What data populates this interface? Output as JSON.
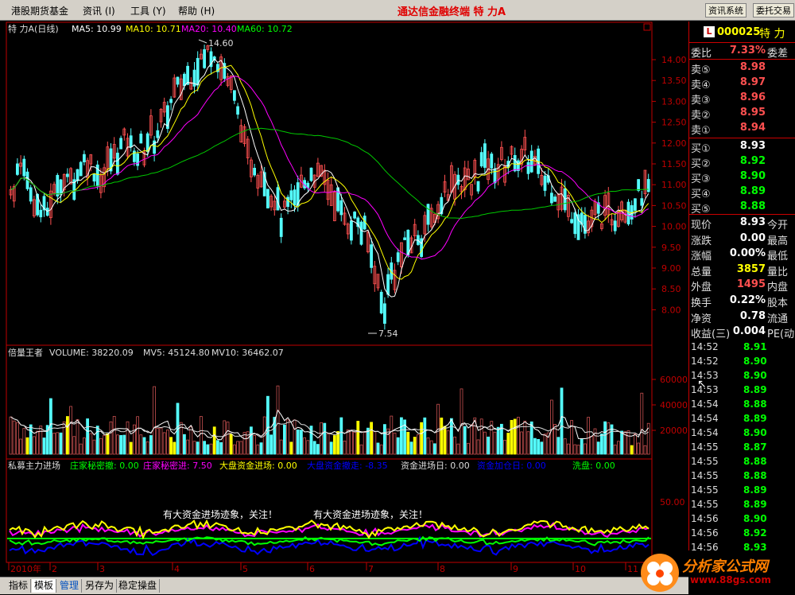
{
  "menubar": {
    "items": [
      "港股期货基金",
      "资讯 (I)",
      "工具 (Y)",
      "帮助 (H)"
    ],
    "title": "通达信金融终端  特  力A",
    "buttons": [
      "资讯系统",
      "委托交易"
    ]
  },
  "price_panel": {
    "header_name": "特  力A(日线)",
    "ma5": "MA5: 10.99",
    "ma10": "MA10: 10.71",
    "ma20": "MA20: 10.40",
    "ma60": "MA60: 10.72",
    "high_label": "14.60",
    "low_label": "7.54",
    "y_ticks": [
      "14.00",
      "13.50",
      "13.00",
      "12.50",
      "12.00",
      "11.50",
      "11.00",
      "10.50",
      "10.00",
      "9.50",
      "9.00",
      "8.50",
      "8.00"
    ]
  },
  "volume_panel": {
    "name": "倍量王者",
    "volume": "VOLUME: 38220.09",
    "mv5": "MV5: 45124.80",
    "mv10": "MV10: 36462.07",
    "y_ticks": [
      "60000",
      "40000",
      "20000"
    ]
  },
  "indicator_panel": {
    "name": "私募主力进场",
    "items": [
      {
        "text": "庄家秘密撤: 0.00",
        "color": "#00ff00"
      },
      {
        "text": "庄家秘密进: 7.50",
        "color": "#ff00ff"
      },
      {
        "text": "大盘资金进场: 0.00",
        "color": "#ffff00"
      },
      {
        "text": "大盘资金撤走: -8.35",
        "color": "#0000ff"
      },
      {
        "text": "资金进场日: 0.00",
        "color": "#dddddd"
      },
      {
        "text": "资金加仓日: 0.00",
        "color": "#0000ff"
      },
      {
        "text": "洗盘: 0.00",
        "color": "#00ff00"
      }
    ],
    "notes": [
      "有大资金进场迹象，关注！",
      "有大资金进场迹象，关注！"
    ],
    "y_tick": "50.00"
  },
  "date_axis": [
    "2010年",
    "2",
    "3",
    "4",
    "5",
    "6",
    "7",
    "8",
    "9",
    "10",
    "11"
  ],
  "quote": {
    "badge": "L",
    "code": "000025",
    "name": "特  力",
    "weibi": {
      "label": "委比",
      "value": "7.33%",
      "label2": "委差"
    },
    "sells": [
      {
        "label": "卖⑤",
        "price": "8.98"
      },
      {
        "label": "卖④",
        "price": "8.97"
      },
      {
        "label": "卖③",
        "price": "8.96"
      },
      {
        "label": "卖②",
        "price": "8.95"
      },
      {
        "label": "卖①",
        "price": "8.94"
      }
    ],
    "buys": [
      {
        "label": "买①",
        "price": "8.93"
      },
      {
        "label": "买②",
        "price": "8.92"
      },
      {
        "label": "买③",
        "price": "8.90"
      },
      {
        "label": "买④",
        "price": "8.89"
      },
      {
        "label": "买⑤",
        "price": "8.88"
      }
    ],
    "stats": [
      {
        "label": "现价",
        "value": "8.93",
        "label2": "今开",
        "color": "#ffffff"
      },
      {
        "label": "涨跌",
        "value": "0.00",
        "label2": "最高",
        "color": "#ffffff"
      },
      {
        "label": "涨幅",
        "value": "0.00%",
        "label2": "最低",
        "color": "#ffffff"
      },
      {
        "label": "总量",
        "value": "3857",
        "label2": "量比",
        "color": "#ffff00"
      },
      {
        "label": "外盘",
        "value": "1495",
        "label2": "内盘",
        "color": "#ff5050"
      },
      {
        "label": "换手",
        "value": "0.22%",
        "label2": "股本",
        "color": "#ffffff"
      },
      {
        "label": "净资",
        "value": "0.78",
        "label2": "流通",
        "color": "#ffffff"
      },
      {
        "label": "收益(三)",
        "value": "0.004",
        "label2": "PE(动",
        "color": "#ffffff"
      }
    ]
  },
  "ticks": [
    {
      "time": "14:52",
      "price": "8.91"
    },
    {
      "time": "14:52",
      "price": "8.90"
    },
    {
      "time": "14:53",
      "price": "8.90"
    },
    {
      "time": "14:53",
      "price": "8.89"
    },
    {
      "time": "14:54",
      "price": "8.88"
    },
    {
      "time": "14:54",
      "price": "8.89"
    },
    {
      "time": "14:54",
      "price": "8.90"
    },
    {
      "time": "14:55",
      "price": "8.87"
    },
    {
      "time": "14:55",
      "price": "8.88"
    },
    {
      "time": "14:55",
      "price": "8.88"
    },
    {
      "time": "14:55",
      "price": "8.89"
    },
    {
      "time": "14:55",
      "price": "8.89"
    },
    {
      "time": "14:56",
      "price": "8.90"
    },
    {
      "time": "14:56",
      "price": "8.92"
    },
    {
      "time": "14:56",
      "price": "8.93"
    }
  ],
  "tabs": [
    "指标",
    "模板",
    "管理",
    "另存为",
    "稳定操盘"
  ],
  "watermark": {
    "text": "分析家公式网",
    "url": "www.88gs.com"
  },
  "colors": {
    "up": "#ff5050",
    "down": "#54fcfc",
    "ma5": "#ffffff",
    "ma10": "#ffff00",
    "ma20": "#ff00ff",
    "ma60": "#00c800",
    "border": "#c00000"
  }
}
